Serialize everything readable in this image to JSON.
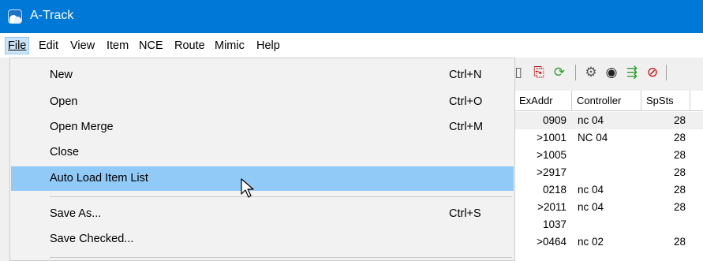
{
  "window": {
    "title": "A-Track"
  },
  "menubar": [
    {
      "label": "File",
      "active": true
    },
    {
      "label": "Edit"
    },
    {
      "label": "View"
    },
    {
      "label": "Item"
    },
    {
      "label": "NCE"
    },
    {
      "label": "Route"
    },
    {
      "label": "Mimic"
    },
    {
      "label": "Help"
    }
  ],
  "file_menu": [
    {
      "label": "New",
      "shortcut": "Ctrl+N"
    },
    {
      "label": "Open",
      "shortcut": "Ctrl+O"
    },
    {
      "label": "Open Merge",
      "shortcut": "Ctrl+M"
    },
    {
      "label": "Close",
      "shortcut": ""
    },
    {
      "label": "Auto Load Item List",
      "shortcut": "",
      "highlighted": true
    },
    {
      "label": "Save As...",
      "shortcut": "Ctrl+S"
    },
    {
      "label": "Save Checked...",
      "shortcut": ""
    }
  ],
  "toolbar": [
    {
      "icon": "document-icon",
      "glyph": "▯"
    },
    {
      "icon": "exit-door-icon",
      "glyph": "⎘"
    },
    {
      "icon": "refresh-icon",
      "glyph": "⟳"
    },
    {
      "icon": "settings-icon",
      "glyph": "⚙"
    },
    {
      "icon": "gauge-icon",
      "glyph": "◉"
    },
    {
      "icon": "route-icon",
      "glyph": "⇶"
    },
    {
      "icon": "stop-icon",
      "glyph": "⊘"
    }
  ],
  "grid": {
    "columns": [
      "ExAddr",
      "Controller",
      "SpSts"
    ],
    "rows": [
      {
        "addr": "0909",
        "controller": "nc 04",
        "spsts": "28"
      },
      {
        "addr": ">1001",
        "controller": "NC 04",
        "spsts": "28"
      },
      {
        "addr": ">1005",
        "controller": "",
        "spsts": "28"
      },
      {
        "addr": ">2917",
        "controller": "",
        "spsts": "28"
      },
      {
        "addr": "0218",
        "controller": "nc 04",
        "spsts": "28"
      },
      {
        "addr": ">2011",
        "controller": "nc 04",
        "spsts": "28"
      },
      {
        "addr": "1037",
        "controller": "",
        "spsts": ""
      },
      {
        "addr": ">0464",
        "controller": "nc 02",
        "spsts": "28"
      }
    ]
  },
  "colors": {
    "titlebar": "#0078d7",
    "menu_highlight": "#91c9f7",
    "menubar_active": "#cce4f7"
  }
}
